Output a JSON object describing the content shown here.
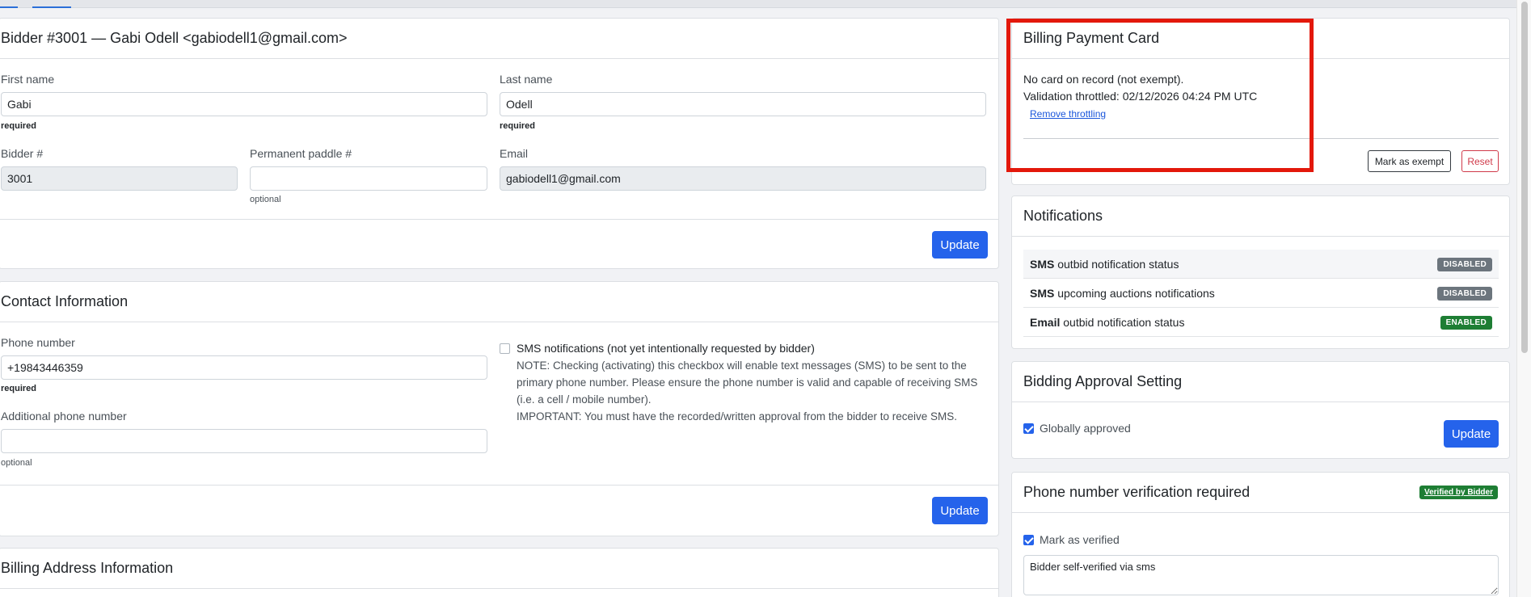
{
  "bidder": {
    "header": "Bidder #3001  — Gabi Odell <gabiodell1@gmail.com>",
    "first_name_label": "First name",
    "first_name_value": "Gabi",
    "first_name_hint": "required",
    "last_name_label": "Last name",
    "last_name_value": "Odell",
    "last_name_hint": "required",
    "bidder_no_label": "Bidder #",
    "bidder_no_value": "3001",
    "paddle_label": "Permanent paddle #",
    "paddle_value": "",
    "paddle_hint": "optional",
    "email_label": "Email",
    "email_value": "gabiodell1@gmail.com",
    "update_label": "Update"
  },
  "contact": {
    "header": "Contact Information",
    "phone_label": "Phone number",
    "phone_value": "+19843446359",
    "phone_hint": "required",
    "additional_phone_label": "Additional phone number",
    "additional_phone_value": "",
    "additional_phone_hint": "optional",
    "sms_label": "SMS notifications (not yet intentionally requested by bidder)",
    "sms_note_1": "NOTE: Checking (activating) this checkbox will enable text messages (SMS) to be sent to the",
    "sms_note_2": "primary phone number. Please ensure the phone number is valid and capable of receiving SMS",
    "sms_note_3": "(i.e. a cell / mobile number).",
    "sms_important": "IMPORTANT: You must have the recorded/written approval from the bidder to receive SMS.",
    "sms_checked": false,
    "update_label": "Update"
  },
  "billing_address": {
    "header": "Billing Address Information"
  },
  "billing_card": {
    "header": "Billing Payment Card",
    "status": "No card on record (not exempt).",
    "throttle": "Validation throttled: 02/12/2026 04:24 PM UTC",
    "remove_link": "Remove throttling",
    "mark_exempt_label": "Mark as exempt",
    "reset_label": "Reset"
  },
  "notifications": {
    "header": "Notifications",
    "rows": [
      {
        "bold": "SMS",
        "text": " outbid notification status",
        "badge": "DISABLED"
      },
      {
        "bold": "SMS",
        "text": " upcoming auctions notifications",
        "badge": "DISABLED"
      },
      {
        "bold": "Email",
        "text": " outbid notification status",
        "badge": "ENABLED"
      }
    ]
  },
  "approval": {
    "header": "Bidding Approval Setting",
    "checkbox_label": "Globally approved",
    "checked": true,
    "update_label": "Update"
  },
  "phone_verification": {
    "header": "Phone number verification required",
    "badge": "Verified by Bidder",
    "checkbox_label": "Mark as verified",
    "checked": true,
    "note_value": "Bidder self-verified via sms"
  },
  "colors": {
    "primary": "#2563eb",
    "highlight": "#e3180b",
    "badge_disabled": "#6c757d",
    "badge_enabled": "#1e7e34"
  }
}
